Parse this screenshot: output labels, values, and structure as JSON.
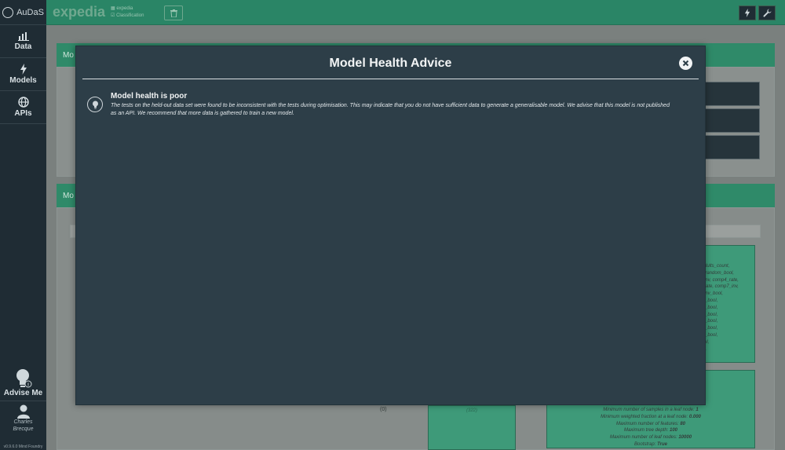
{
  "sidebar": {
    "brand": "AuDaS",
    "nav": [
      {
        "label": "Data",
        "icon": "bar-chart-icon"
      },
      {
        "label": "Models",
        "icon": "lightning-icon"
      },
      {
        "label": "APIs",
        "icon": "globe-icon"
      }
    ],
    "advise_label": "Advise Me",
    "user_name": "Charles Brecque",
    "version": "v0.9.6.0 Mind Foundry"
  },
  "topbar": {
    "dataset_title": "expedia",
    "dataset_name": "expedia",
    "problem_type": "Classification"
  },
  "background": {
    "panel1_head": "Mo",
    "panel2_head": "Mo",
    "features_text": [
      "h_adults_count,",
      "ool, random_bool,",
      "p3_inv, comp4_rate,",
      "p7_rate, comp7_inv,",
      "p1_inv_bool,",
      "_inv_bool,",
      "_inv_bool,",
      "_inv_bool,",
      "_inv_bool,",
      "_inv_bool,",
      "_inv_bool,",
      "_bool,",
      "bool."
    ],
    "params": [
      {
        "label": "Minimum number of samples in a leaf node:",
        "value": "1"
      },
      {
        "label": "Minimum weighted fraction at a leaf node:",
        "value": "0.000"
      },
      {
        "label": "Maximum number of features:",
        "value": "80"
      },
      {
        "label": "Maximum tree depth:",
        "value": "100"
      },
      {
        "label": "Maximum number of leaf nodes:",
        "value": "10000"
      },
      {
        "label": "Bootstrap:",
        "value": "True"
      }
    ],
    "zero_label": "(0)",
    "green_count": "(322)"
  },
  "modal": {
    "title": "Model Health Advice",
    "advice_title": "Model health is poor",
    "advice_body": "The tests on the held-out data set were found to be inconsistent with the tests during optimisation. This may indicate that you do not have sufficient data to generate a generalisable model. We advise that this model is not published as an API. We recommend that more data is gathered to train a new model."
  },
  "colors": {
    "sidebar_bg": "#1f2c34",
    "topbar_bg": "#2a8566",
    "modal_bg": "#2d3e48",
    "accent_green": "#2f8a69"
  }
}
